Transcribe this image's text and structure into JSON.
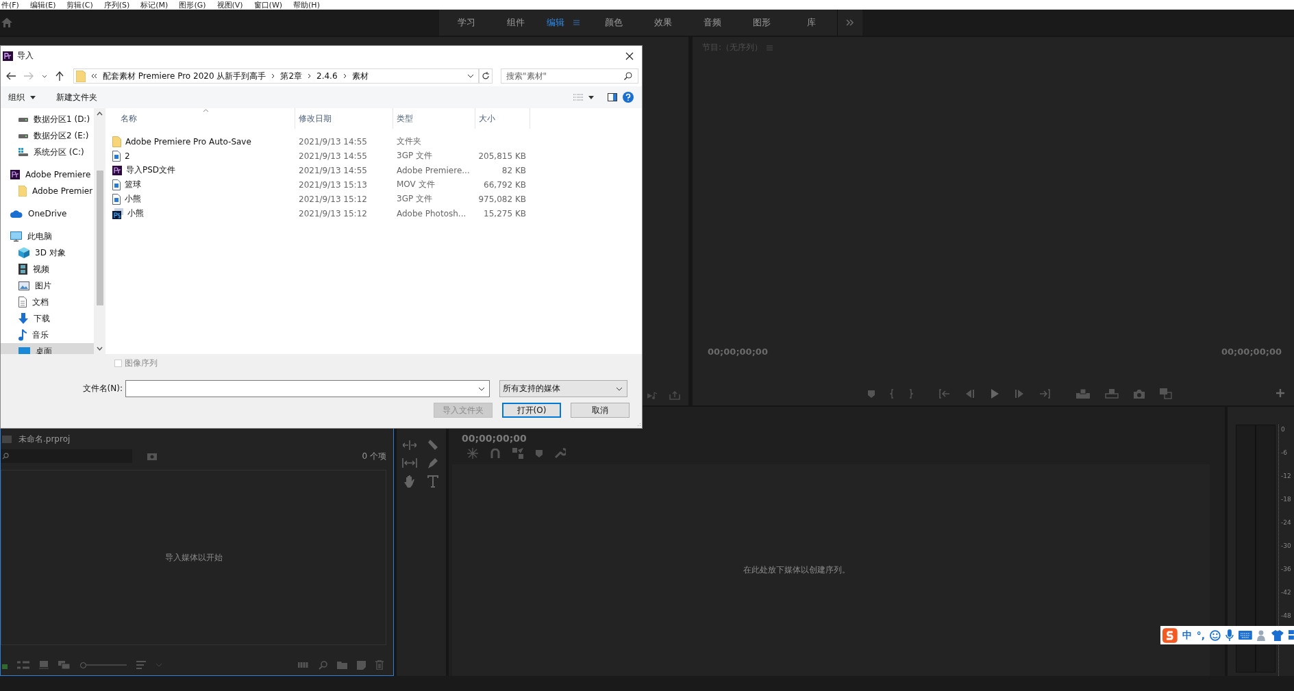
{
  "menu_bar": [
    "件(F)",
    "编辑(E)",
    "剪辑(C)",
    "序列(S)",
    "标记(M)",
    "图形(G)",
    "视图(V)",
    "窗口(W)",
    "帮助(H)"
  ],
  "workspaces": [
    {
      "label": "学习",
      "selected": false
    },
    {
      "label": "组件",
      "selected": false
    },
    {
      "label": "编辑",
      "selected": true
    },
    {
      "label": "颜色",
      "selected": false
    },
    {
      "label": "效果",
      "selected": false
    },
    {
      "label": "音频",
      "selected": false
    },
    {
      "label": "图形",
      "selected": false
    },
    {
      "label": "库",
      "selected": false
    }
  ],
  "program_monitor": {
    "title": "节目:（无序列）",
    "timecode_left": "00;00;00;00",
    "timecode_right": "00;00;00;00"
  },
  "project_panel": {
    "title": "未命名.prproj",
    "item_count": "0 个项",
    "empty_message": "导入媒体以开始",
    "zoom_slider": {
      "level": 0
    }
  },
  "timeline": {
    "timecode": "00;00;00;00",
    "empty_message": "在此处放下媒体以创建序列。"
  },
  "audio_meter": {
    "scale": [
      "0",
      "-6",
      "-12",
      "-18",
      "-24",
      "-30",
      "-36",
      "-42",
      "-48"
    ]
  },
  "ime_toolbar": {
    "mode": "中",
    "punctuation": "°,"
  },
  "dialog": {
    "title": "导入",
    "breadcrumb": [
      "配套素材 Premiere Pro 2020 从新手到高手",
      "第2章",
      "2.4.6",
      "素材"
    ],
    "search": {
      "placeholder": "搜索\"素材\""
    },
    "toolbar": {
      "organize": "组织",
      "new_folder": "新建文件夹"
    },
    "nav_groups": [
      [
        {
          "children": [
            {
              "label": "数据分区1 (D:)",
              "kind": "drive",
              "selected": false
            },
            {
              "label": "数据分区2 (E:)",
              "kind": "drive",
              "selected": false
            },
            {
              "label": "系统分区 (C:)",
              "kind": "system",
              "selected": false
            }
          ]
        }
      ],
      [
        {
          "label": "Adobe Premiere",
          "kind": "pr",
          "selected": false,
          "children": [
            {
              "label": "Adobe Premier",
              "kind": "folder",
              "selected": false
            }
          ]
        }
      ],
      [
        {
          "label": "OneDrive",
          "kind": "cloud",
          "selected": false
        }
      ],
      [
        {
          "label": "此电脑",
          "kind": "pc",
          "selected": false,
          "children": [
            {
              "label": "3D 对象",
              "kind": "cube",
              "selected": false
            },
            {
              "label": "视频",
              "kind": "film",
              "selected": false
            },
            {
              "label": "图片",
              "kind": "image",
              "selected": false
            },
            {
              "label": "文档",
              "kind": "doc",
              "selected": false
            },
            {
              "label": "下载",
              "kind": "download",
              "selected": false
            },
            {
              "label": "音乐",
              "kind": "music",
              "selected": false
            },
            {
              "label": "桌面",
              "kind": "desktop",
              "selected": true
            }
          ]
        }
      ]
    ],
    "columns": [
      "名称",
      "修改日期",
      "类型",
      "大小"
    ],
    "files": [
      {
        "kind": "folder",
        "name": "Adobe Premiere Pro Auto-Save",
        "date": "2021/9/13 14:55",
        "type": "文件夹"
      },
      {
        "kind": "video",
        "name": "2",
        "date": "2021/9/13 14:55",
        "type": "3GP 文件",
        "size": "205,815 KB"
      },
      {
        "kind": "pr",
        "name": "导入PSD文件",
        "date": "2021/9/13 14:55",
        "type": "Adobe Premiere...",
        "size": "82 KB"
      },
      {
        "kind": "video",
        "name": "篮球",
        "date": "2021/9/13 15:13",
        "type": "MOV 文件",
        "size": "66,792 KB"
      },
      {
        "kind": "video",
        "name": "小熊",
        "date": "2021/9/13 15:12",
        "type": "3GP 文件",
        "size": "975,082 KB"
      },
      {
        "kind": "ps",
        "name": "小熊",
        "date": "2021/9/13 15:12",
        "type": "Adobe Photosh...",
        "size": "15,275 KB"
      }
    ],
    "image_sequence": {
      "label": "图像序列",
      "checked": false,
      "disabled": true
    },
    "file_name": {
      "label": "文件名(N):"
    },
    "file_type": "所有支持的媒体",
    "buttons": [
      {
        "label": "导入文件夹",
        "kind": "normal",
        "disabled": true
      },
      {
        "label": "打开(O)",
        "kind": "default",
        "disabled": false
      },
      {
        "label": "取消",
        "kind": "normal",
        "disabled": false
      }
    ]
  }
}
